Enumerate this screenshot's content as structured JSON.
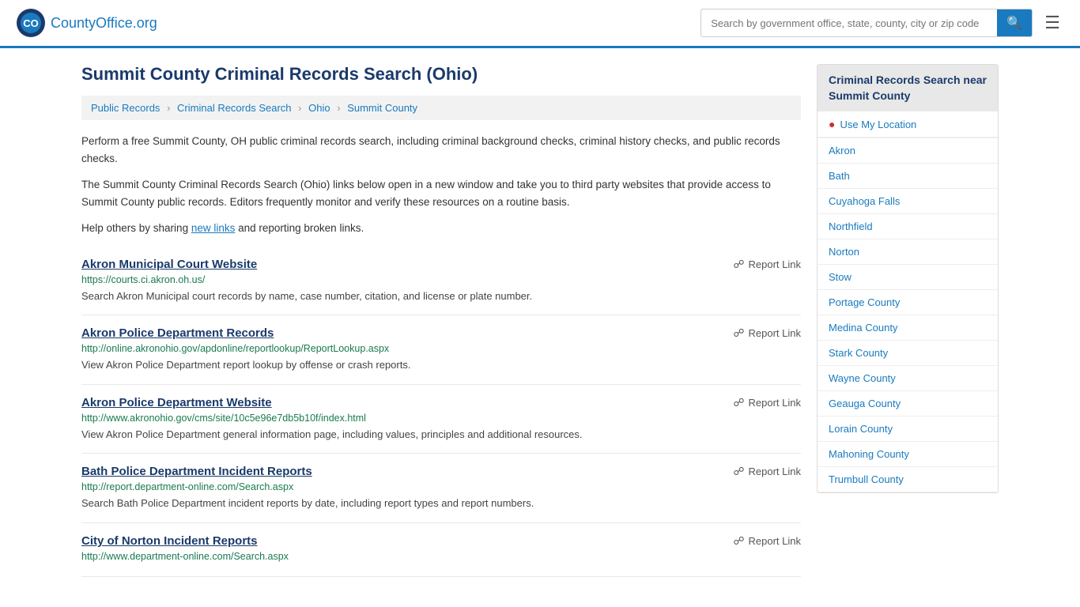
{
  "header": {
    "logo_text": "CountyOffice",
    "logo_tld": ".org",
    "search_placeholder": "Search by government office, state, county, city or zip code",
    "search_value": ""
  },
  "page": {
    "title": "Summit County Criminal Records Search (Ohio)",
    "breadcrumb": [
      {
        "label": "Public Records",
        "href": "#"
      },
      {
        "label": "Criminal Records Search",
        "href": "#"
      },
      {
        "label": "Ohio",
        "href": "#"
      },
      {
        "label": "Summit County",
        "href": "#"
      }
    ],
    "description1": "Perform a free Summit County, OH public criminal records search, including criminal background checks, criminal history checks, and public records checks.",
    "description2": "The Summit County Criminal Records Search (Ohio) links below open in a new window and take you to third party websites that provide access to Summit County public records. Editors frequently monitor and verify these resources on a routine basis.",
    "description3_prefix": "Help others by sharing ",
    "description3_link": "new links",
    "description3_suffix": " and reporting broken links."
  },
  "results": [
    {
      "title": "Akron Municipal Court Website",
      "url": "https://courts.ci.akron.oh.us/",
      "desc": "Search Akron Municipal court records by name, case number, citation, and license or plate number.",
      "report_label": "Report Link"
    },
    {
      "title": "Akron Police Department Records",
      "url": "http://online.akronohio.gov/apdonline/reportlookup/ReportLookup.aspx",
      "desc": "View Akron Police Department report lookup by offense or crash reports.",
      "report_label": "Report Link"
    },
    {
      "title": "Akron Police Department Website",
      "url": "http://www.akronohio.gov/cms/site/10c5e96e7db5b10f/index.html",
      "desc": "View Akron Police Department general information page, including values, principles and additional resources.",
      "report_label": "Report Link"
    },
    {
      "title": "Bath Police Department Incident Reports",
      "url": "http://report.department-online.com/Search.aspx",
      "desc": "Search Bath Police Department incident reports by date, including report types and report numbers.",
      "report_label": "Report Link"
    },
    {
      "title": "City of Norton Incident Reports",
      "url": "http://www.department-online.com/Search.aspx",
      "desc": "",
      "report_label": "Report Link"
    }
  ],
  "sidebar": {
    "title": "Criminal Records Search near Summit County",
    "use_location_label": "Use My Location",
    "links": [
      {
        "label": "Akron"
      },
      {
        "label": "Bath"
      },
      {
        "label": "Cuyahoga Falls"
      },
      {
        "label": "Northfield"
      },
      {
        "label": "Norton"
      },
      {
        "label": "Stow"
      },
      {
        "label": "Portage County"
      },
      {
        "label": "Medina County"
      },
      {
        "label": "Stark County"
      },
      {
        "label": "Wayne County"
      },
      {
        "label": "Geauga County"
      },
      {
        "label": "Lorain County"
      },
      {
        "label": "Mahoning County"
      },
      {
        "label": "Trumbull County"
      }
    ]
  }
}
